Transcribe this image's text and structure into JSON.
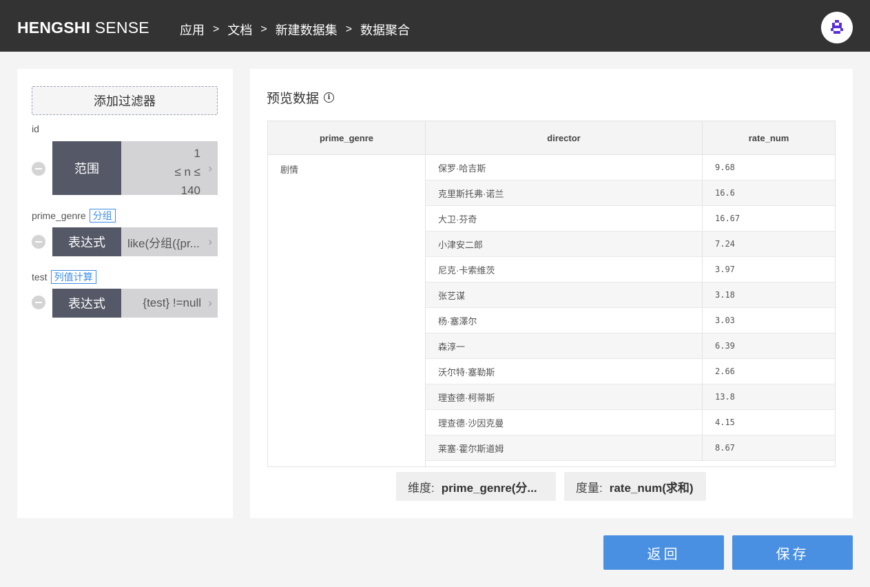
{
  "header": {
    "brand_bold": "HENGSHI",
    "brand_rest": "SENSE",
    "breadcrumb": [
      "应用",
      "文档",
      "新建数据集",
      "数据聚合"
    ],
    "separator": ">"
  },
  "filters": {
    "add_label": "添加过滤器",
    "items": [
      {
        "field": "id",
        "tag": "",
        "type": "范围",
        "range_min": "1",
        "range_op": "≤ n ≤",
        "range_max": "140"
      },
      {
        "field": "prime_genre",
        "tag": "分组",
        "type": "表达式",
        "value": "like(分组({pr..."
      },
      {
        "field": "test",
        "tag": "列值计算",
        "type": "表达式",
        "value": "{test} !=null"
      }
    ]
  },
  "preview": {
    "title": "预览数据",
    "info_icon": "i",
    "columns": [
      "prime_genre",
      "director",
      "rate_num"
    ],
    "genre": "剧情",
    "rows": [
      {
        "director": "保罗·哈吉斯",
        "rate": "9.68"
      },
      {
        "director": "克里斯托弗·诺兰",
        "rate": "16.6"
      },
      {
        "director": "大卫·芬奇",
        "rate": "16.67"
      },
      {
        "director": "小津安二郎",
        "rate": "7.24"
      },
      {
        "director": "尼克·卡索维茨",
        "rate": "3.97"
      },
      {
        "director": "张艺谋",
        "rate": "3.18"
      },
      {
        "director": "杨·塞澤尔",
        "rate": "3.03"
      },
      {
        "director": "森淳一",
        "rate": "6.39"
      },
      {
        "director": "沃尔特·塞勒斯",
        "rate": "2.66"
      },
      {
        "director": "理查德·柯蒂斯",
        "rate": "13.8"
      },
      {
        "director": "理查德·沙因克曼",
        "rate": "4.15"
      },
      {
        "director": "莱塞·霍尔斯道姆",
        "rate": "8.67"
      }
    ],
    "dimension_label": "维度:",
    "dimension_value": "prime_genre(分...",
    "measure_label": "度量:",
    "measure_value": "rate_num(求和)"
  },
  "actions": {
    "back": "返回",
    "save": "保存"
  },
  "colors": {
    "header_bg": "#333333",
    "primary": "#4a90e2",
    "filter_type_bg": "#555866",
    "tag_blue": "#3b8ee8",
    "avatar_purple": "#5b2fd6"
  },
  "icons": {
    "avatar": "pixel-robot-icon",
    "info": "info-circle-icon",
    "chevron": "chevron-right-icon",
    "remove": "minus-circle-icon"
  }
}
